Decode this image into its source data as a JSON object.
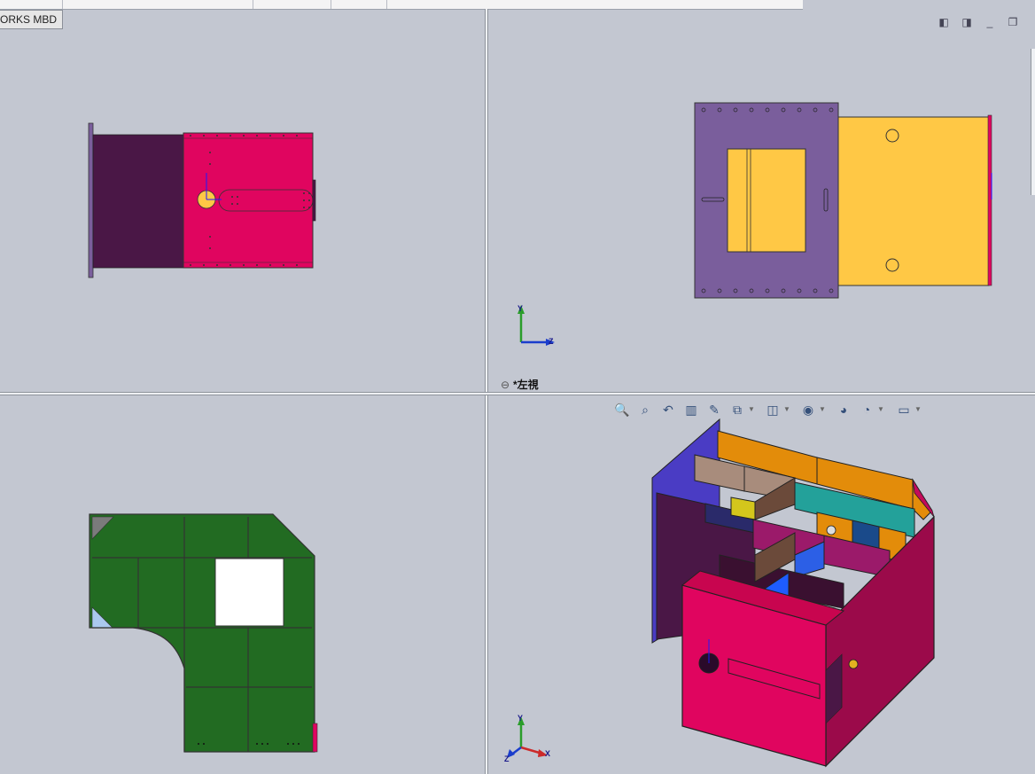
{
  "app": {
    "mbd_tab_label": "ORKS MBD"
  },
  "viewports": {
    "top_right": {
      "label": "*左視",
      "label_icon": "link-icon"
    },
    "triad_top_right": {
      "y": "Y",
      "z": "Z"
    },
    "triad_bottom_right": {
      "y": "Y",
      "z": "Z",
      "x": "X"
    }
  },
  "window_controls": [
    "◧",
    "◨",
    "_",
    "❐"
  ],
  "heads_up_toolbar": [
    {
      "icon": "zoom-to-fit-icon",
      "glyph": "🔍"
    },
    {
      "icon": "zoom-to-area-icon",
      "glyph": "⌕"
    },
    {
      "icon": "previous-view-icon",
      "glyph": "↶"
    },
    {
      "icon": "section-view-icon",
      "glyph": "▥"
    },
    {
      "icon": "dynamic-annotation-icon",
      "glyph": "✎"
    },
    {
      "icon": "view-orientation-icon",
      "glyph": "⧉"
    },
    {
      "icon": "display-style-icon",
      "glyph": "◫"
    },
    {
      "icon": "hide-show-items-icon",
      "glyph": "◉"
    },
    {
      "icon": "edit-appearance-icon",
      "glyph": "◕"
    },
    {
      "icon": "apply-scene-icon",
      "glyph": "◔"
    },
    {
      "icon": "view-settings-icon",
      "glyph": "▭"
    }
  ],
  "colors": {
    "viewport_bg": "#c3c7d1",
    "magenta_panel": "#e0055f",
    "dark_purple_panel": "#4a1746",
    "lavender_panel": "#7a5e9c",
    "yellow_panel": "#ffc845",
    "green_panel": "#226b22",
    "orange_panel": "#e38c0a",
    "teal_panel": "#23a19a",
    "blue_panel": "#2c5fe6"
  }
}
